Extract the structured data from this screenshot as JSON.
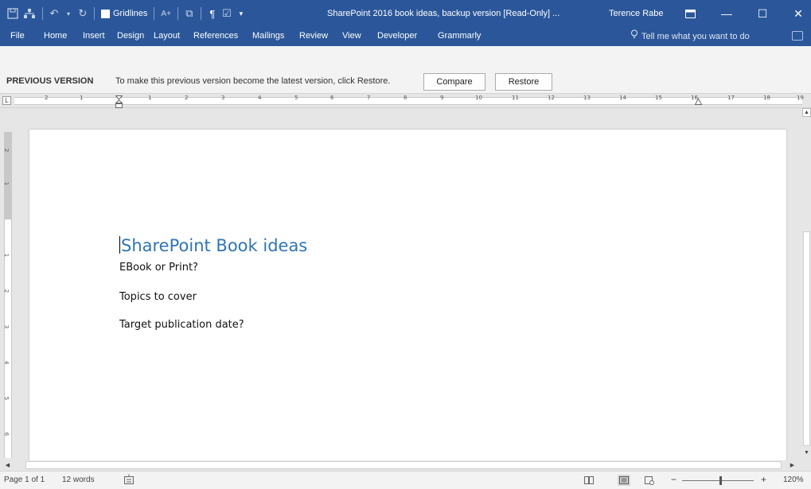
{
  "titlebar": {
    "gridlines_label": "Gridlines",
    "document_title": "SharePoint 2016 book ideas, backup version [Read-Only] ...",
    "user_name": "Terence Rabe",
    "accent": "#2b579a"
  },
  "ribbon": {
    "tabs": [
      "File",
      "Home",
      "Insert",
      "Design",
      "Layout",
      "References",
      "Mailings",
      "Review",
      "View",
      "Developer",
      "Grammarly"
    ],
    "tell_me": "Tell me what you want to do"
  },
  "infobar": {
    "title": "PREVIOUS VERSION",
    "message": "To make this previous version become the latest version, click Restore.",
    "compare_label": "Compare",
    "restore_label": "Restore"
  },
  "ruler": {
    "corner": "L",
    "ticks": [
      "2",
      "1",
      "1",
      "2",
      "3",
      "4",
      "5",
      "6",
      "7",
      "8",
      "9",
      "10",
      "11",
      "12",
      "13",
      "14",
      "15",
      "16",
      "17",
      "18",
      "19"
    ],
    "vertical_ticks": [
      "2",
      "1",
      "1",
      "2",
      "3",
      "4",
      "5",
      "6"
    ]
  },
  "document": {
    "heading": "SharePoint Book ideas",
    "lines": [
      "EBook or Print?",
      "Topics to cover",
      "Target publication date?"
    ]
  },
  "statusbar": {
    "page": "Page 1 of 1",
    "words": "12 words",
    "zoom": "120%",
    "zoom_minus": "−",
    "zoom_plus": "+"
  }
}
